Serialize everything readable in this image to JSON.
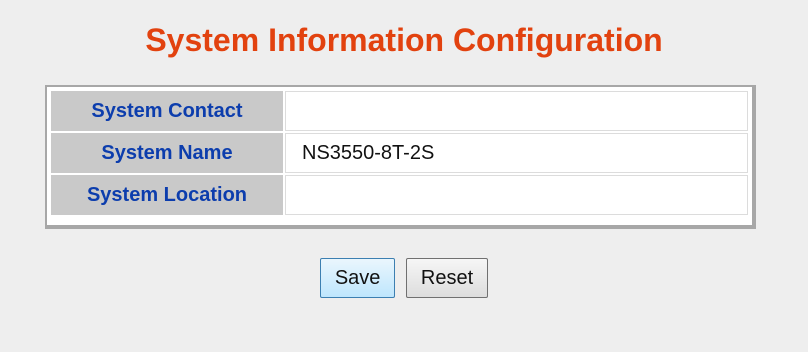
{
  "header": {
    "title": "System Information Configuration"
  },
  "form": {
    "rows": [
      {
        "label": "System Contact",
        "value": ""
      },
      {
        "label": "System Name",
        "value": "NS3550-8T-2S"
      },
      {
        "label": "System Location",
        "value": ""
      }
    ]
  },
  "buttons": {
    "save_label": "Save",
    "reset_label": "Reset"
  },
  "colors": {
    "title": "#e2420f",
    "label_text": "#0c3dad",
    "label_background": "#c9c9c9",
    "page_background": "#eeeeee"
  }
}
